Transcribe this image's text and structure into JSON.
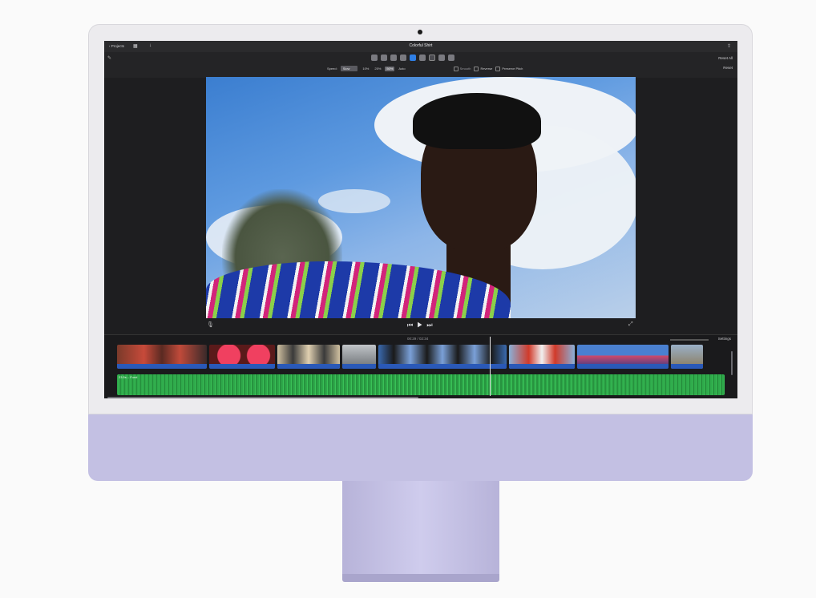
{
  "app": {
    "title": "Colorful Shirt",
    "back_label": "‹ Projects",
    "reset_all_label": "Reset All",
    "reset_label": "Reset"
  },
  "toolbar": {
    "tools": [
      {
        "name": "color-balance-icon",
        "active": false
      },
      {
        "name": "color-correction-icon",
        "active": false
      },
      {
        "name": "crop-icon",
        "active": false
      },
      {
        "name": "stabilization-icon",
        "active": false
      },
      {
        "name": "volume-icon",
        "active": true
      },
      {
        "name": "noise-reduction-icon",
        "active": false
      },
      {
        "name": "speed-icon",
        "selected": true
      },
      {
        "name": "clip-filter-icon",
        "active": false
      },
      {
        "name": "info-icon",
        "active": false
      }
    ],
    "speed_label": "Speed:",
    "speed_value": "Slow",
    "speed_options": [
      "10%",
      "25%",
      "50%",
      "Auto"
    ],
    "speed_selected": "50%",
    "smooth_label": "Smooth",
    "reverse_label": "Reverse",
    "preserve_pitch_label": "Preserve Pitch"
  },
  "viewer": {
    "timecode_current": "00:29",
    "timecode_total": "02:34",
    "settings_label": "Settings"
  },
  "timeline": {
    "audio_label": "23.5s – Fund"
  },
  "colors": {
    "chin": "#c3c0e3",
    "accent": "#2f7fe6",
    "audio": "#2ea84a"
  }
}
